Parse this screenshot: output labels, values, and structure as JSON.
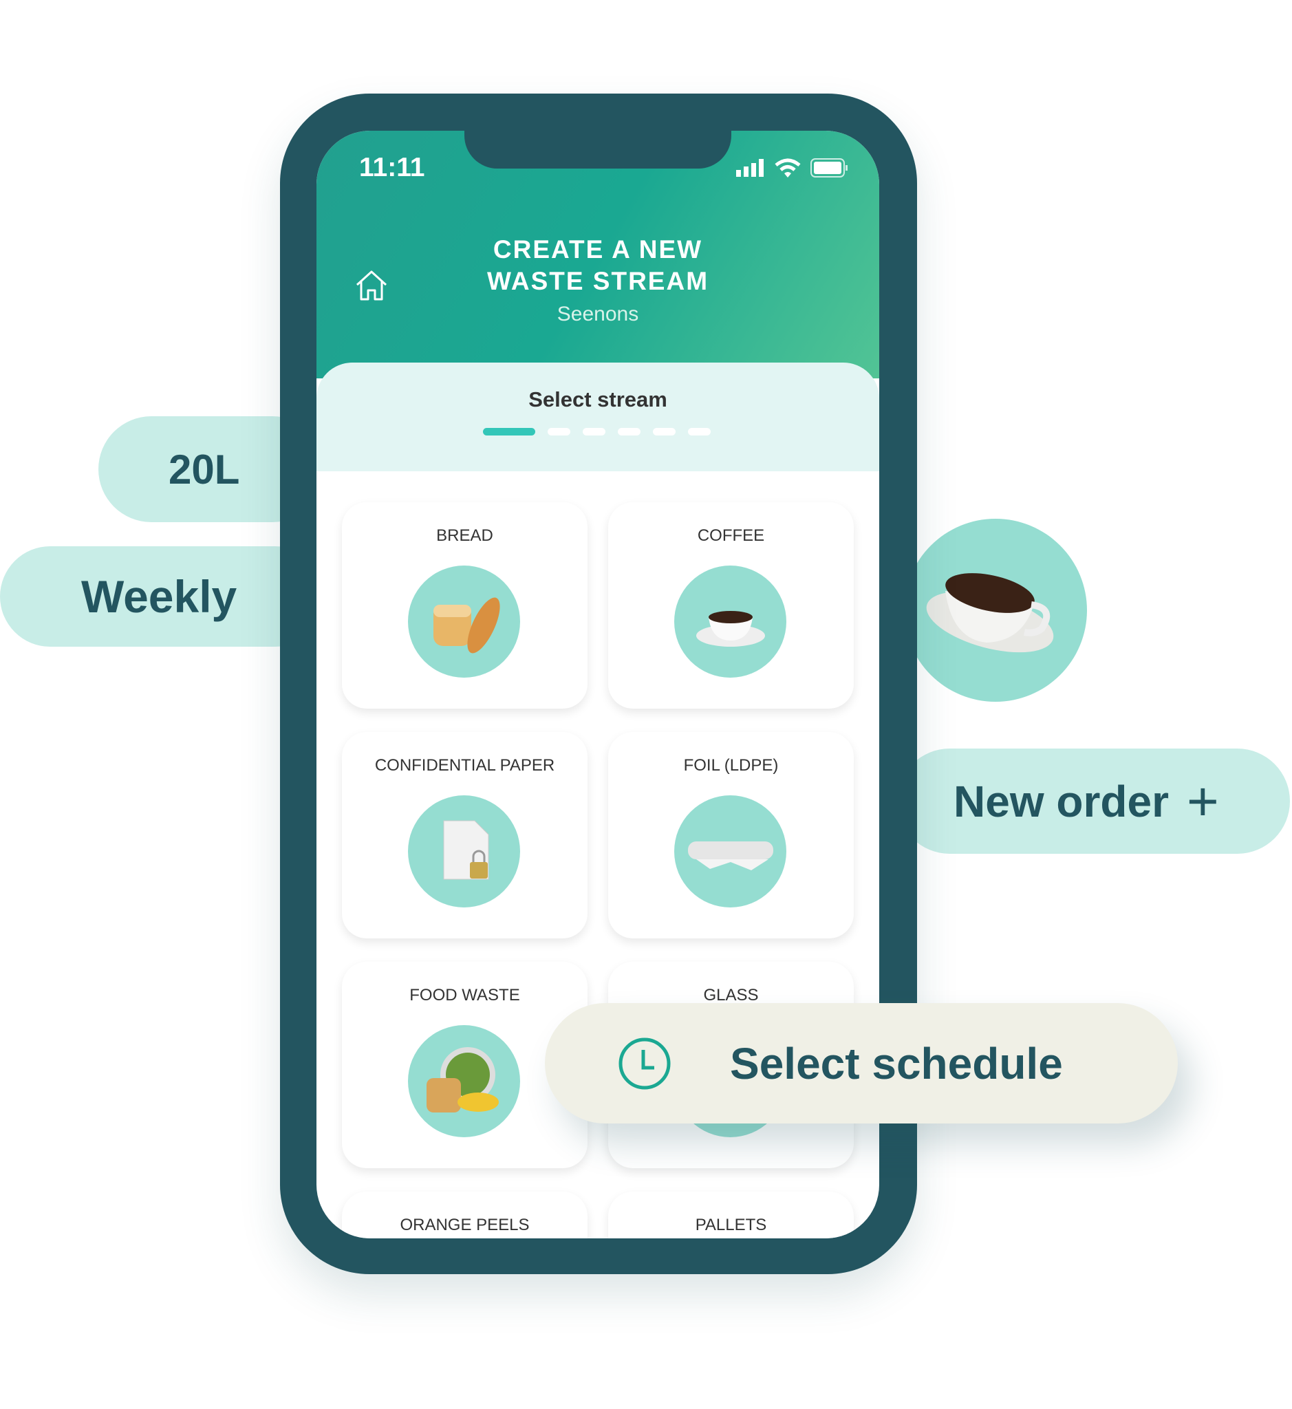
{
  "floating": {
    "volume": "20L",
    "frequency": "Weekly",
    "new_order": "New order",
    "new_order_plus": "+",
    "select_schedule": "Select schedule"
  },
  "status_bar": {
    "time": "11:11"
  },
  "header": {
    "title_line1": "CREATE A NEW",
    "title_line2": "WASTE STREAM",
    "subtitle": "Seenons"
  },
  "step": {
    "title": "Select stream",
    "total_steps": 6,
    "current_step": 1
  },
  "streams": [
    {
      "label": "BREAD",
      "icon": "bread-icon"
    },
    {
      "label": "COFFEE",
      "icon": "coffee-icon"
    },
    {
      "label": "CONFIDENTIAL PAPER",
      "icon": "confidential-paper-icon"
    },
    {
      "label": "FOIL (LDPE)",
      "icon": "foil-roll-icon"
    },
    {
      "label": "FOOD WASTE",
      "icon": "food-waste-icon"
    },
    {
      "label": "GLASS",
      "icon": "glass-icon"
    },
    {
      "label": "ORANGE PEELS",
      "icon": "orange-peels-icon"
    },
    {
      "label": "PALLETS",
      "icon": "pallets-icon"
    }
  ],
  "colors": {
    "brand_dark": "#235560",
    "accent": "#33c6b8",
    "pill": "#c8ede7",
    "icon_bg": "#95ddd1"
  }
}
